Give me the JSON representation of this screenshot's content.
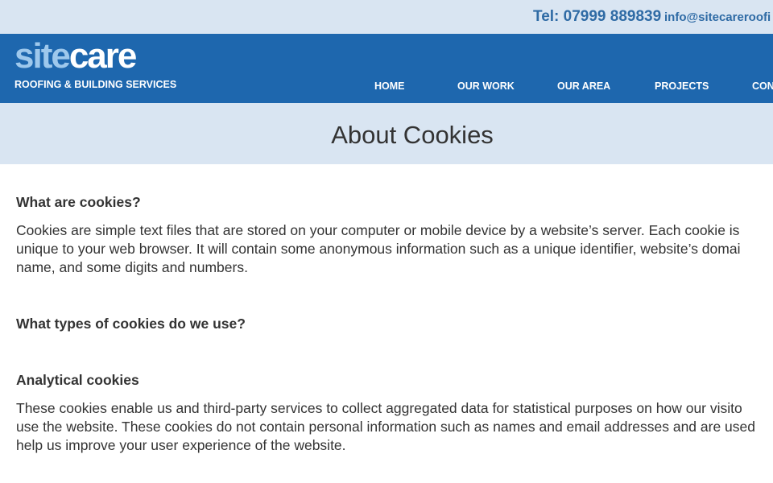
{
  "topbar": {
    "tel": "Tel: 07999 889839",
    "email": "info@sitecareroofi"
  },
  "brand": {
    "word_a": "site",
    "word_b": "care",
    "tagline": "ROOFING & BUILDING SERVICES",
    "colors": {
      "header": "#1e67ae",
      "light_band": "#d9e5f2",
      "accent_text": "#2f6ba5",
      "logo_light": "#9ec8ec"
    }
  },
  "nav": {
    "items": [
      {
        "label": "HOME"
      },
      {
        "label": "OUR WORK"
      },
      {
        "label": "OUR AREA"
      },
      {
        "label": "PROJECTS"
      },
      {
        "label": "CON"
      }
    ]
  },
  "page": {
    "title": "About Cookies"
  },
  "content": {
    "sections": [
      {
        "heading": "What are cookies?",
        "lines": [
          "Cookies are simple text files that are stored on your computer or mobile device by a website’s server. Each cookie is",
          "unique to your web browser. It will contain some anonymous information such as a unique identifier, website’s domai",
          "name, and some digits and numbers."
        ]
      },
      {
        "heading": "What types of cookies do we use?",
        "lines": []
      },
      {
        "heading": "Analytical cookies",
        "lines": [
          "These cookies enable us and third-party services to collect aggregated data for statistical purposes on how our visito",
          "use the website. These cookies do not contain personal information such as names and email addresses and are used",
          "help us improve your user experience of the website."
        ]
      }
    ]
  }
}
